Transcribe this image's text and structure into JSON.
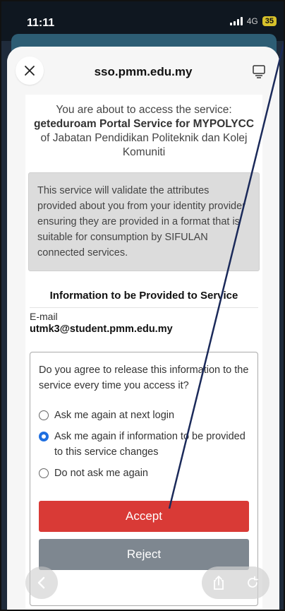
{
  "status_bar": {
    "time": "11:11",
    "network": "4G",
    "battery": "35"
  },
  "browser": {
    "url": "sso.pmm.edu.my"
  },
  "intro": {
    "prefix": "You are about to access the service:",
    "service_name": "geteduroam Portal Service for MYPOLYCC",
    "suffix": " of Jabatan Pendidikan Politeknik dan Kolej Komuniti"
  },
  "info_box": {
    "text": "This service will validate the attributes provided about you from your identity provider ensuring they are provided in a format that is suitable for consumption by SIFULAN connected services."
  },
  "attributes": {
    "title": "Information to be Provided to Service",
    "items": [
      {
        "name": "E-mail",
        "value": "utmk3@student.pmm.edu.my"
      }
    ]
  },
  "consent": {
    "question": "Do you agree to release this information to the service every time you access it?",
    "options": [
      {
        "label": "Ask me again at next login",
        "checked": false
      },
      {
        "label": "Ask me again if information to be provided to this service changes",
        "checked": true
      },
      {
        "label": "Do not ask me again",
        "checked": false
      }
    ],
    "accept_label": "Accept",
    "reject_label": "Reject"
  },
  "icons": {
    "close": "close-icon",
    "reader": "reader-icon",
    "back": "back-icon",
    "share": "share-icon",
    "reload": "reload-icon"
  },
  "colors": {
    "accept": "#d93a36",
    "reject": "#7e8790",
    "radio_checked": "#1f6fe0",
    "annotation_arrow": "#1b2a5a"
  }
}
